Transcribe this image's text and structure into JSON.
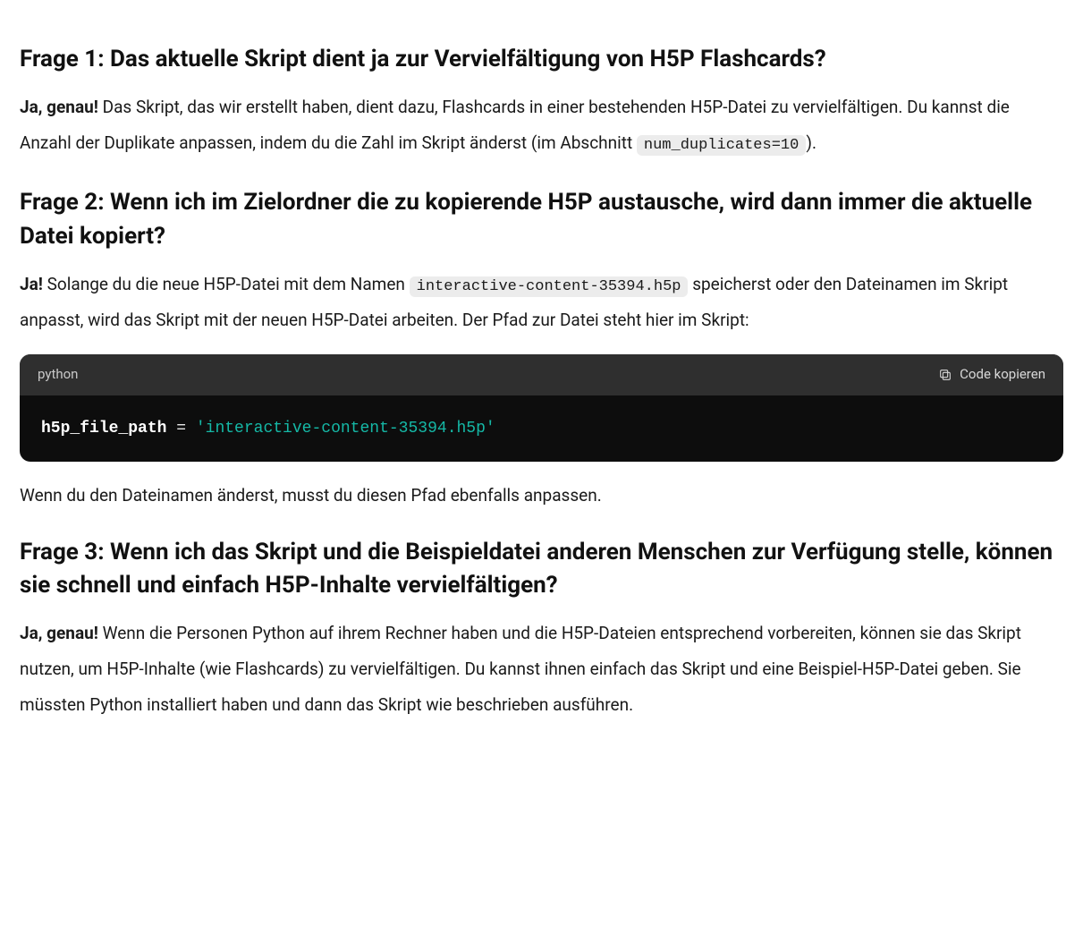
{
  "q1": {
    "heading": "Frage 1: Das aktuelle Skript dient ja zur Vervielfältigung von H5P Flashcards?",
    "answer_bold": "Ja, genau!",
    "answer_before_code": " Das Skript, das wir erstellt haben, dient dazu, Flashcards in einer bestehenden H5P-Datei zu vervielfältigen. Du kannst die Anzahl der Duplikate anpassen, indem du die Zahl im Skript änderst (im Abschnitt ",
    "inline_code": "num_duplicates=10",
    "answer_after_code": ")."
  },
  "q2": {
    "heading": "Frage 2: Wenn ich im Zielordner die zu kopierende H5P austausche, wird dann immer die aktuelle Datei kopiert?",
    "answer_bold": "Ja!",
    "answer_before_code": " Solange du die neue H5P-Datei mit dem Namen ",
    "inline_code": "interactive-content-35394.h5p",
    "answer_after_code": " speicherst oder den Dateinamen im Skript anpasst, wird das Skript mit der neuen H5P-Datei arbeiten. Der Pfad zur Datei steht hier im Skript:",
    "code_lang": "python",
    "copy_label": "Code kopieren",
    "code_var": "h5p_file_path",
    "code_op": " = ",
    "code_str": "'interactive-content-35394.h5p'",
    "note": "Wenn du den Dateinamen änderst, musst du diesen Pfad ebenfalls anpassen."
  },
  "q3": {
    "heading": "Frage 3: Wenn ich das Skript und die Beispieldatei anderen Menschen zur Verfügung stelle, können sie schnell und einfach H5P-Inhalte vervielfältigen?",
    "answer_bold": "Ja, genau!",
    "answer_rest": " Wenn die Personen Python auf ihrem Rechner haben und die H5P-Dateien entsprechend vorbereiten, können sie das Skript nutzen, um H5P-Inhalte (wie Flashcards) zu vervielfältigen. Du kannst ihnen einfach das Skript und eine Beispiel-H5P-Datei geben. Sie müssten Python installiert haben und dann das Skript wie beschrieben ausführen."
  }
}
